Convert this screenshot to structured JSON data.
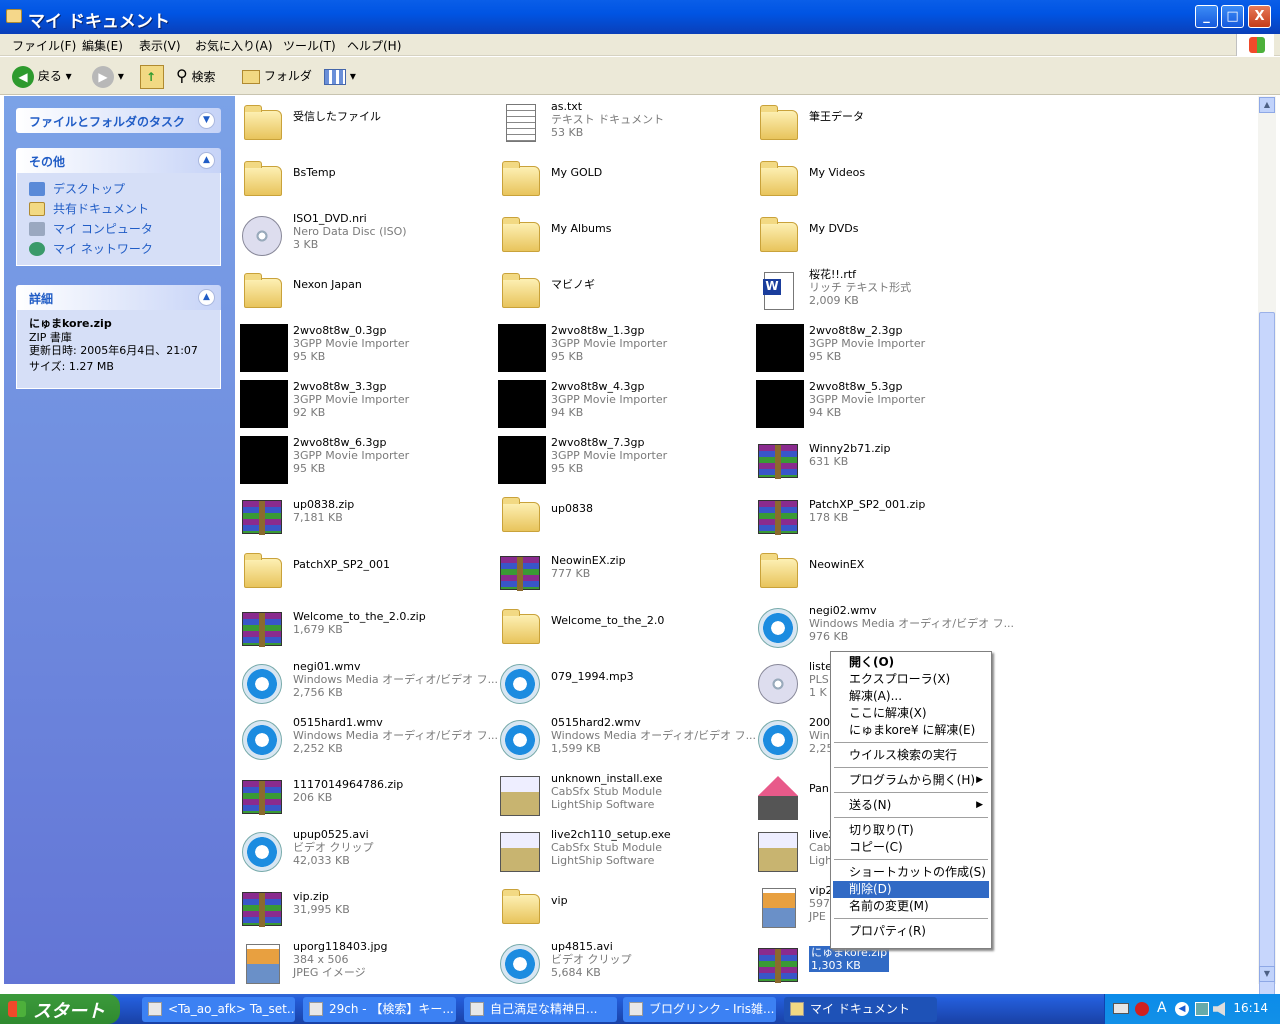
{
  "window": {
    "title": "マイ ドキュメント",
    "minimize": "_",
    "maximize": "□",
    "close": "X"
  },
  "menu": [
    "ファイル(F)",
    "編集(E)",
    "表示(V)",
    "お気に入り(A)",
    "ツール(T)",
    "ヘルプ(H)"
  ],
  "toolbar": {
    "back": "戻る",
    "search": "検索",
    "folders": "フォルダ"
  },
  "sidebar": {
    "tasks_title": "ファイルとフォルダのタスク",
    "other_title": "その他",
    "other_links": [
      "デスクトップ",
      "共有ドキュメント",
      "マイ コンピュータ",
      "マイ ネットワーク"
    ],
    "details_title": "詳細",
    "details": {
      "name": "にゅまkore.zip",
      "type": "ZIP 書庫",
      "modified": "更新日時: 2005年6月4日、21:07",
      "size": "サイズ: 1.27 MB"
    }
  },
  "files": [
    {
      "name": "受信したファイル",
      "icon": "folder"
    },
    {
      "name": "as.txt",
      "d1": "テキスト ドキュメント",
      "d2": "53 KB",
      "icon": "text-doc"
    },
    {
      "name": "筆王データ",
      "icon": "folder"
    },
    {
      "name": "BsTemp",
      "icon": "folder"
    },
    {
      "name": "My GOLD",
      "icon": "folder"
    },
    {
      "name": "My Videos",
      "icon": "folder"
    },
    {
      "name": "ISO1_DVD.nri",
      "d1": "Nero Data Disc (ISO)",
      "d2": "3 KB",
      "icon": "disc"
    },
    {
      "name": "My Albums",
      "icon": "folder"
    },
    {
      "name": "My DVDs",
      "icon": "folder"
    },
    {
      "name": "Nexon Japan",
      "icon": "folder"
    },
    {
      "name": "マビノギ",
      "icon": "folder"
    },
    {
      "name": "桜花!!.rtf",
      "d1": "リッチ テキスト形式",
      "d2": "2,009 KB",
      "icon": "word"
    },
    {
      "name": "2wvo8t8w_0.3gp",
      "d1": "3GPP Movie Importer",
      "d2": "95 KB",
      "icon": "black"
    },
    {
      "name": "2wvo8t8w_1.3gp",
      "d1": "3GPP Movie Importer",
      "d2": "95 KB",
      "icon": "black"
    },
    {
      "name": "2wvo8t8w_2.3gp",
      "d1": "3GPP Movie Importer",
      "d2": "95 KB",
      "icon": "black"
    },
    {
      "name": "2wvo8t8w_3.3gp",
      "d1": "3GPP Movie Importer",
      "d2": "92 KB",
      "icon": "black"
    },
    {
      "name": "2wvo8t8w_4.3gp",
      "d1": "3GPP Movie Importer",
      "d2": "94 KB",
      "icon": "black"
    },
    {
      "name": "2wvo8t8w_5.3gp",
      "d1": "3GPP Movie Importer",
      "d2": "94 KB",
      "icon": "black"
    },
    {
      "name": "2wvo8t8w_6.3gp",
      "d1": "3GPP Movie Importer",
      "d2": "95 KB",
      "icon": "black"
    },
    {
      "name": "2wvo8t8w_7.3gp",
      "d1": "3GPP Movie Importer",
      "d2": "95 KB",
      "icon": "black"
    },
    {
      "name": "Winny2b71.zip",
      "d1": "631 KB",
      "icon": "zip"
    },
    {
      "name": "up0838.zip",
      "d1": "7,181 KB",
      "icon": "zip"
    },
    {
      "name": "up0838",
      "icon": "folder"
    },
    {
      "name": "PatchXP_SP2_001.zip",
      "d1": "178 KB",
      "icon": "zip"
    },
    {
      "name": "PatchXP_SP2_001",
      "icon": "folder"
    },
    {
      "name": "NeowinEX.zip",
      "d1": "777 KB",
      "icon": "zip"
    },
    {
      "name": "NeowinEX",
      "icon": "folder"
    },
    {
      "name": "Welcome_to_the_2.0.zip",
      "d1": "1,679 KB",
      "icon": "zip"
    },
    {
      "name": "Welcome_to_the_2.0",
      "icon": "folder"
    },
    {
      "name": "negi02.wmv",
      "d1": "Windows Media オーディオ/ビデオ フ...",
      "d2": "976 KB",
      "icon": "media"
    },
    {
      "name": "negi01.wmv",
      "d1": "Windows Media オーディオ/ビデオ フ...",
      "d2": "2,756 KB",
      "icon": "media"
    },
    {
      "name": "079_1994.mp3",
      "icon": "media"
    },
    {
      "name": "liste",
      "d1": "PLS",
      "d2": "1 K",
      "icon": "disc"
    },
    {
      "name": "0515hard1.wmv",
      "d1": "Windows Media オーディオ/ビデオ フ...",
      "d2": "2,252 KB",
      "icon": "media"
    },
    {
      "name": "0515hard2.wmv",
      "d1": "Windows Media オーディオ/ビデオ フ...",
      "d2": "1,599 KB",
      "icon": "media"
    },
    {
      "name": "200",
      "d1": "Win",
      "d2": "2,25",
      "icon": "media"
    },
    {
      "name": "1117014964786.zip",
      "d1": "206 KB",
      "icon": "zip"
    },
    {
      "name": "unknown_install.exe",
      "d1": "CabSfx Stub Module",
      "d2": "LightShip Software",
      "icon": "exe"
    },
    {
      "name": "Pan",
      "icon": "nsis"
    },
    {
      "name": "upup0525.avi",
      "d1": "ビデオ クリップ",
      "d2": "42,033 KB",
      "icon": "media"
    },
    {
      "name": "live2ch110_setup.exe",
      "d1": "CabSfx Stub Module",
      "d2": "LightShip Software",
      "icon": "exe"
    },
    {
      "name": "live2",
      "d1": "Cab",
      "d2": "Ligh",
      "icon": "exe"
    },
    {
      "name": "vip.zip",
      "d1": "31,995 KB",
      "icon": "zip"
    },
    {
      "name": "vip",
      "icon": "folder"
    },
    {
      "name": "vip2",
      "d1": "597",
      "d2": "JPE",
      "icon": "jpg"
    },
    {
      "name": "uporg118403.jpg",
      "d1": "384 x 506",
      "d2": "JPEG イメージ",
      "icon": "jpg"
    },
    {
      "name": "up4815.avi",
      "d1": "ビデオ クリップ",
      "d2": "5,684 KB",
      "icon": "media"
    },
    {
      "name": "にゅまkore.zip",
      "d1": "1,303 KB",
      "icon": "zip",
      "selected": true
    }
  ],
  "context_menu": [
    {
      "label": "開く(O)",
      "bold": true
    },
    {
      "label": "エクスプローラ(X)"
    },
    {
      "label": "解凍(A)..."
    },
    {
      "label": "ここに解凍(X)"
    },
    {
      "label": "にゅまkore¥ に解凍(E)"
    },
    {
      "sep": true
    },
    {
      "label": "ウイルス検索の実行"
    },
    {
      "sep": true
    },
    {
      "label": "プログラムから開く(H)",
      "sub": true
    },
    {
      "sep": true
    },
    {
      "label": "送る(N)",
      "sub": true
    },
    {
      "sep": true
    },
    {
      "label": "切り取り(T)"
    },
    {
      "label": "コピー(C)"
    },
    {
      "sep": true
    },
    {
      "label": "ショートカットの作成(S)"
    },
    {
      "label": "削除(D)",
      "highlight": true
    },
    {
      "label": "名前の変更(M)"
    },
    {
      "sep": true
    },
    {
      "label": "プロパティ(R)"
    }
  ],
  "taskbar": {
    "start": "スタート",
    "tasks": [
      "<Ta_ao_afk> Ta_set...",
      "29ch - 【検索】キー...",
      "自己満足な精神日...",
      "ブログリンク - Iris雑...",
      "マイ ドキュメント"
    ],
    "clock": "16:14"
  }
}
